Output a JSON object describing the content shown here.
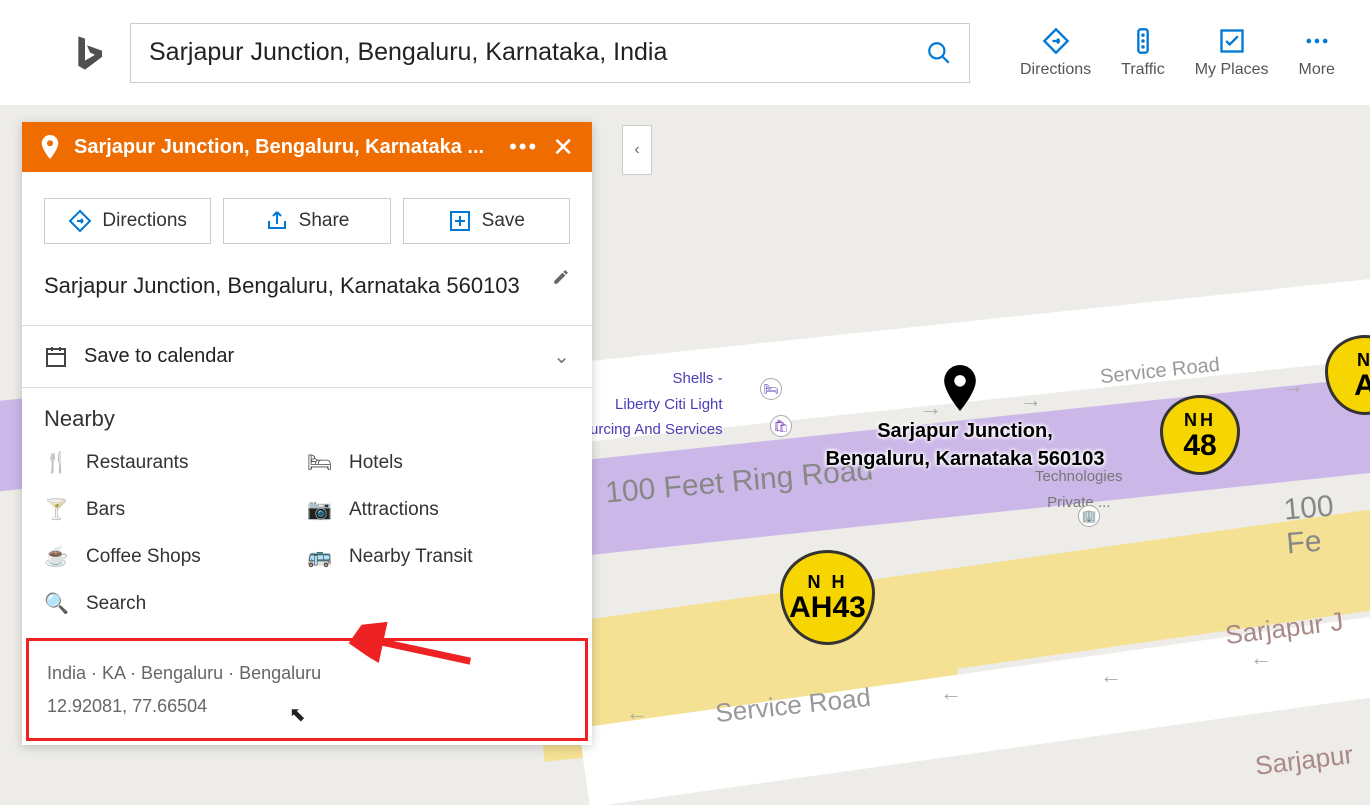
{
  "search": {
    "value": "Sarjapur Junction, Bengaluru, Karnataka, India"
  },
  "nav": {
    "directions": "Directions",
    "traffic": "Traffic",
    "myplaces": "My Places",
    "more": "More"
  },
  "panel": {
    "header_title": "Sarjapur Junction, Bengaluru, Karnataka ...",
    "actions": {
      "directions": "Directions",
      "share": "Share",
      "save": "Save"
    },
    "address": "Sarjapur Junction, Bengaluru, Karnataka 560103",
    "calendar": "Save to calendar",
    "nearby_title": "Nearby",
    "nearby": {
      "restaurants": "Restaurants",
      "hotels": "Hotels",
      "bars": "Bars",
      "attractions": "Attractions",
      "coffee": "Coffee Shops",
      "transit": "Nearby Transit",
      "search": "Search"
    },
    "footer_breadcrumb": "India · KA · Bengaluru · Bengaluru",
    "footer_coords": "12.92081, 77.66504"
  },
  "map": {
    "pin_label_1": "Sarjapur Junction,",
    "pin_label_2": "Bengaluru, Karnataka 560103",
    "road_100ft": "100 Feet Ring Road",
    "road_100ft_r": "100 Fe",
    "road_service": "Service Road",
    "road_service2": "Service Road",
    "road_sarjapur": "Sarjapur J",
    "road_sarjapur2": "Sarjapur",
    "poi_shells_1": "Shells -",
    "poi_shells_2": "Liberty Citi Light",
    "poi_shells_3": "urcing And Services",
    "poi_tech_1": "Technologies",
    "poi_tech_2": "Private ...",
    "shield1_top": "N H",
    "shield1_bot": "AH43",
    "shield2_top": "NH",
    "shield2_bot": "48",
    "shield3_top": "N",
    "shield3_bot": "A"
  }
}
